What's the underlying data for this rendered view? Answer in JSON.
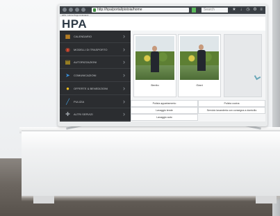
{
  "browser": {
    "url": "http://hpa/portal/pistoia/home",
    "search_placeholder": "Search",
    "tab_title": "HPA - Home Page Ambulanti"
  },
  "app": {
    "logo": "HPA"
  },
  "sidebar": {
    "items": [
      {
        "label": "CALENDARIO",
        "icon": "calendar-icon",
        "color": "#f0a020",
        "glyph": "▦"
      },
      {
        "label": "MODELLI DI TRASPORTO",
        "icon": "car-icon",
        "color": "#e04a2f",
        "glyph": "◉"
      },
      {
        "label": "AUTORIZZAZIONI",
        "icon": "document-icon",
        "color": "#f5c518",
        "glyph": "▤"
      },
      {
        "label": "COMUNICAZIONI",
        "icon": "send-icon",
        "color": "#3a8fd8",
        "glyph": "➤"
      },
      {
        "label": "OFFERTE & BENEDIZIONI",
        "icon": "lightbulb-icon",
        "color": "#f0c020",
        "glyph": "●"
      },
      {
        "label": "PULIZIA",
        "icon": "brush-icon",
        "color": "#4aa3e0",
        "glyph": "╱"
      },
      {
        "label": "ALTRI SERVIZI",
        "icon": "wrench-icon",
        "color": "#9aa0a6",
        "glyph": "✚"
      }
    ]
  },
  "photos": [
    {
      "caption": "Benito"
    },
    {
      "caption": "Giani"
    }
  ],
  "actions": [
    {
      "label": "Pulizia appartamento"
    },
    {
      "label": "Pulizia cucina"
    },
    {
      "label": "Lavaggio tende"
    },
    {
      "label": "Servizio lavanderia con consegna a domicilio"
    },
    {
      "label": "Lavaggio auto"
    }
  ]
}
